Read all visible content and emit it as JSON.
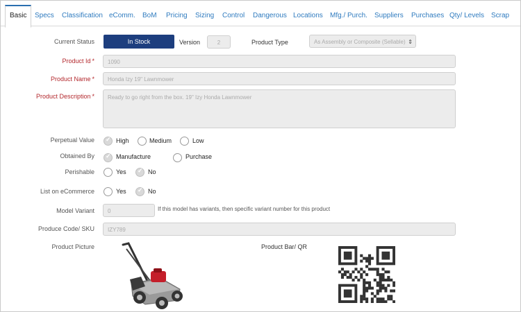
{
  "tabs": [
    "Basic",
    "Specs",
    "Classification",
    "eComm.",
    "BoM",
    "Pricing",
    "Sizing",
    "Control",
    "Dangerous",
    "Locations",
    "Mfg./ Purch.",
    "Suppliers",
    "Purchases",
    "Qty/ Levels",
    "Scrap"
  ],
  "form": {
    "current_status": {
      "label": "Current Status",
      "value": "In Stock"
    },
    "version": {
      "label": "Version",
      "value": "2"
    },
    "product_type": {
      "label": "Product Type",
      "value": "As Assembly or Composite (Sellable)"
    },
    "product_id": {
      "label": "Product Id",
      "required": "*",
      "value": "1090"
    },
    "product_name": {
      "label": "Product Name",
      "required": "*",
      "value": "Honda Izy 19\" Lawnmower"
    },
    "product_description": {
      "label": "Product Description",
      "required": "*",
      "value": "Ready to go right from the box. 19\" Izy Honda Lawnmower"
    },
    "perpetual_value": {
      "label": "Perpetual Value",
      "options": [
        "High",
        "Medium",
        "Low"
      ],
      "selected": "High"
    },
    "obtained_by": {
      "label": "Obtained By",
      "options": [
        "Manufacture",
        "Purchase"
      ],
      "selected": "Manufacture"
    },
    "perishable": {
      "label": "Perishable",
      "options": [
        "Yes",
        "No"
      ],
      "selected": "No"
    },
    "list_on_ecommerce": {
      "label": "List on eCommerce",
      "options": [
        "Yes",
        "No"
      ],
      "selected": "No"
    },
    "model_variant": {
      "label": "Model Variant",
      "value": "0",
      "hint": "If this model has variants, then specific variant number for this product"
    },
    "produce_code": {
      "label": "Produce Code/ SKU",
      "value": "IZY789"
    },
    "product_picture": {
      "label": "Product Picture"
    },
    "product_barcode": {
      "label": "Product Bar/ QR"
    }
  },
  "icons": {
    "product_image": "lawnmower-image",
    "qr": "qr-code",
    "select_caret": "updown-caret-icon"
  },
  "colors": {
    "accent": "#2f7bbf",
    "status": "#1d3e7e",
    "required": "#b3282d"
  }
}
